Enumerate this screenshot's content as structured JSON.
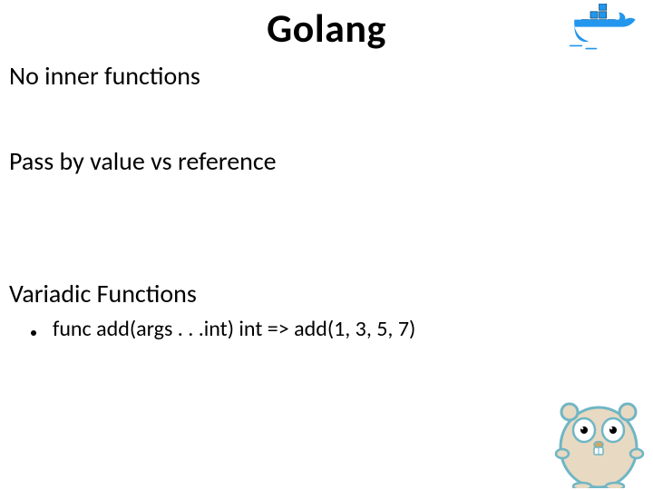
{
  "title": "Golang",
  "sections": {
    "s1": "No inner functions",
    "s2": "Pass by value vs reference",
    "s3": "Variadic Functions"
  },
  "bullet": "func add(args . . .int) int  => add(1, 3, 5, 7)",
  "icons": {
    "top_right": "docker-logo",
    "bottom_right": "gopher-mascot"
  },
  "colors": {
    "docker_blue": "#2396ED",
    "docker_dark": "#394D54",
    "gopher_body": "#E8D9C2",
    "gopher_outline": "#6FB6C4"
  }
}
